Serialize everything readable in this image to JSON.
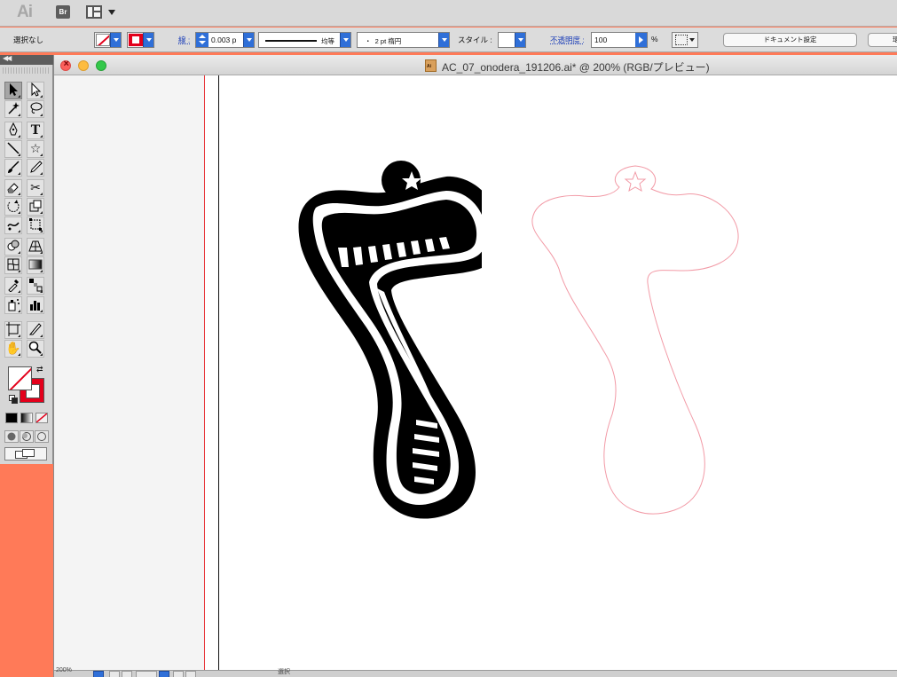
{
  "app": {
    "logo": "Ai",
    "bridge_button": "Br"
  },
  "control_bar": {
    "selection_label": "選択なし",
    "stroke_label": "線 :",
    "stroke_weight": "0.003 p",
    "stroke_profile": "均等",
    "brush": "・  2 pt 楕円",
    "style_label": "スタイル :",
    "opacity_label": "不透明度 :",
    "opacity_value": "100",
    "opacity_unit": "%",
    "document_settings_button": "ドキュメント設定",
    "preferences_button": "環",
    "colors": {
      "fill_none_slash": "#e3001b",
      "stroke": "#e3001b",
      "accent_blue": "#2f6fd8"
    }
  },
  "tools": [
    {
      "id": "selection",
      "icon": "selection-arrow-icon"
    },
    {
      "id": "direct-selection",
      "icon": "direct-selection-arrow-icon"
    },
    {
      "id": "magic-wand",
      "icon": "magic-wand-icon"
    },
    {
      "id": "lasso",
      "icon": "lasso-icon"
    },
    {
      "id": "pen",
      "icon": "pen-icon"
    },
    {
      "id": "type",
      "icon": "type-icon",
      "glyph": "T"
    },
    {
      "id": "line",
      "icon": "line-segment-icon"
    },
    {
      "id": "star",
      "icon": "star-icon",
      "glyph": "☆"
    },
    {
      "id": "paintbrush",
      "icon": "paintbrush-icon"
    },
    {
      "id": "pencil",
      "icon": "pencil-icon"
    },
    {
      "id": "eraser",
      "icon": "eraser-icon"
    },
    {
      "id": "scissors",
      "icon": "scissors-icon",
      "glyph": "✂"
    },
    {
      "id": "rotate",
      "icon": "rotate-icon"
    },
    {
      "id": "scale",
      "icon": "scale-icon"
    },
    {
      "id": "warp",
      "icon": "warp-icon"
    },
    {
      "id": "free-transform",
      "icon": "free-transform-icon"
    },
    {
      "id": "shape-builder",
      "icon": "shape-builder-icon"
    },
    {
      "id": "perspective-grid",
      "icon": "perspective-grid-icon"
    },
    {
      "id": "mesh",
      "icon": "mesh-icon"
    },
    {
      "id": "gradient",
      "icon": "gradient-icon"
    },
    {
      "id": "eyedropper",
      "icon": "eyedropper-icon"
    },
    {
      "id": "blend",
      "icon": "blend-icon"
    },
    {
      "id": "symbol-sprayer",
      "icon": "symbol-sprayer-icon"
    },
    {
      "id": "column-graph",
      "icon": "column-graph-icon"
    },
    {
      "id": "artboard",
      "icon": "artboard-icon"
    },
    {
      "id": "slice",
      "icon": "slice-icon"
    },
    {
      "id": "hand",
      "icon": "hand-icon",
      "glyph": "✋"
    },
    {
      "id": "zoom",
      "icon": "zoom-icon"
    }
  ],
  "document": {
    "title": "AC_07_onodera_191206.ai* @ 200% (RGB/プレビュー)",
    "artwork": {
      "glyph": "7",
      "fill_color": "#000000",
      "outline_color": "#f29aa6",
      "bleed_color": "#e8373b"
    }
  },
  "status": {
    "zoom": "200%",
    "info": "選択"
  }
}
